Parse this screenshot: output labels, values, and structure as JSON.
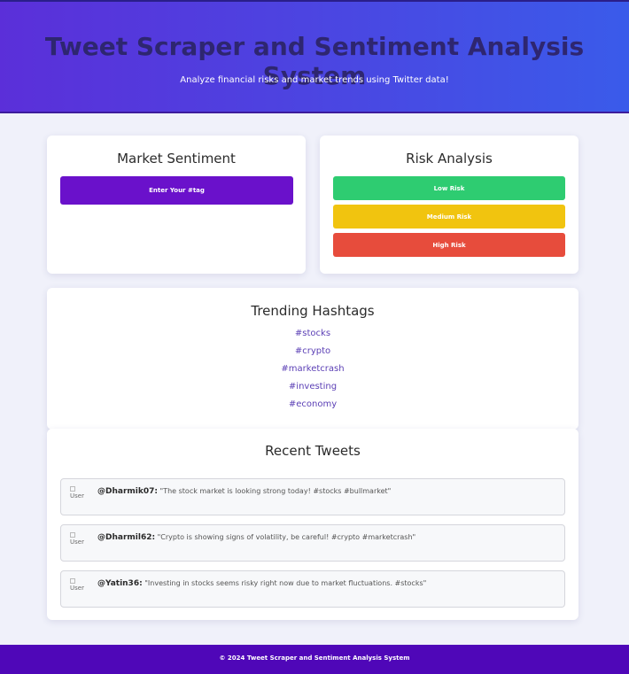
{
  "header": {
    "title": "Tweet Scraper and Sentiment Analysis System",
    "subtitle": "Analyze financial risks and market trends using Twitter data!"
  },
  "market_sentiment": {
    "title": "Market Sentiment",
    "button_label": "Enter Your #tag"
  },
  "risk_analysis": {
    "title": "Risk Analysis",
    "levels": [
      {
        "label": "Low Risk",
        "color": "#2ecc71"
      },
      {
        "label": "Medium Risk",
        "color": "#f1c40f"
      },
      {
        "label": "High Risk",
        "color": "#e74c3c"
      }
    ]
  },
  "trending": {
    "title": "Trending Hashtags",
    "tags": [
      "#stocks",
      "#crypto",
      "#marketcrash",
      "#investing",
      "#economy"
    ]
  },
  "recent_tweets": {
    "title": "Recent Tweets",
    "avatar_alt": "User",
    "tweets": [
      {
        "user": "@Dharmik07:",
        "text": "\"The stock market is looking strong today! #stocks #bullmarket\""
      },
      {
        "user": "@Dharmil62:",
        "text": "\"Crypto is showing signs of volatility, be careful! #crypto #marketcrash\""
      },
      {
        "user": "@Yatin36:",
        "text": "\"Investing in stocks seems risky right now due to market fluctuations. #stocks\""
      }
    ]
  },
  "footer": {
    "text": "© 2024 Tweet Scraper and Sentiment Analysis System"
  },
  "colors": {
    "accent": "#6a11cb",
    "footer_bg": "#4f07b8"
  }
}
